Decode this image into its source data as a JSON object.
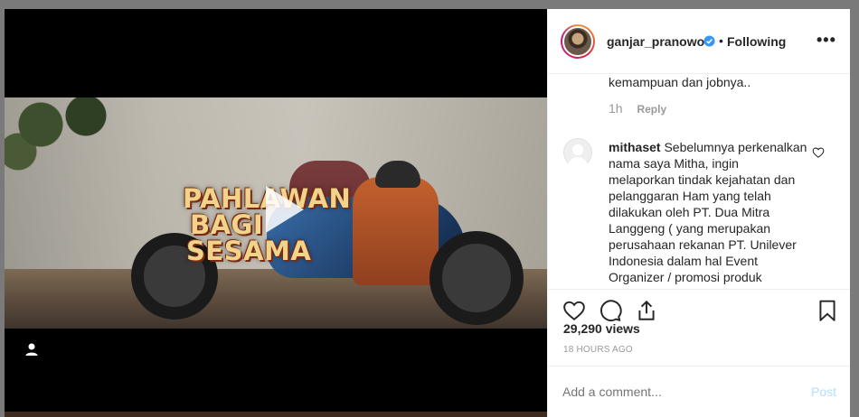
{
  "video": {
    "overlay_title": [
      "PAHLAWAN",
      "BAGI",
      "SESAMA"
    ]
  },
  "header": {
    "username": "ganjar_pranowo",
    "separator": "•",
    "follow_status": "Following",
    "more": "•••"
  },
  "comments": {
    "previous_tail": "kemampuan dan jobnya..",
    "previous_time": "1h",
    "reply_label": "Reply",
    "items": [
      {
        "username": "mithaset",
        "text": "Sebelumnya perkenalkan nama saya Mitha, ingin melaporkan tindak kejahatan dan pelanggaran Ham yang telah dilakukan oleh PT. Dua Mitra Langgeng ( yang merupakan perusahaan rekanan PT. Unilever Indonesia dalam hal Event Organizer / promosi produk"
      }
    ]
  },
  "stats": {
    "views": "29,290 views",
    "time_ago": "18 HOURS AGO"
  },
  "composer": {
    "placeholder": "Add a comment...",
    "post_label": "Post"
  },
  "colors": {
    "accent": "#3897f0",
    "post_disabled": "#b2dffc",
    "muted": "#999999",
    "text": "#262626"
  }
}
